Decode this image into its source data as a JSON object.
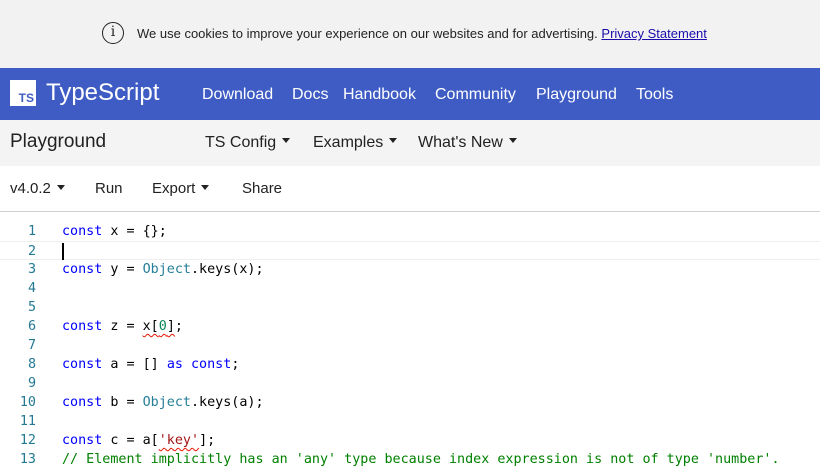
{
  "cookie_banner": {
    "icon": "info-icon",
    "message": "We use cookies to improve your experience on our websites and for advertising.",
    "link": "Privacy Statement"
  },
  "topnav": {
    "logo_text": "TS",
    "brand": "TypeScript",
    "links": [
      "Download",
      "Docs",
      "Handbook",
      "Community",
      "Playground",
      "Tools"
    ],
    "background": "#3f5cc4"
  },
  "playground_header": {
    "title": "Playground",
    "menus": [
      "TS Config",
      "Examples",
      "What's New"
    ]
  },
  "toolbar": {
    "version": "v4.0.2",
    "run": "Run",
    "export": "Export",
    "share": "Share"
  },
  "editor": {
    "line_numbers": [
      "1",
      "2",
      "3",
      "4",
      "5",
      "6",
      "7",
      "8",
      "9",
      "10",
      "11",
      "12",
      "13"
    ],
    "tokens": {
      "const": "const",
      "as": "as",
      "Object": "Object",
      "l1_rest": " x = {};",
      "l3_a": " y = ",
      "l3_b": ".keys(x);",
      "l6_a": " z = ",
      "l6_b": "x[",
      "l6_num": "0",
      "l6_c": "]",
      "l6_d": ";",
      "l8_a": " a = [] ",
      "l8_b": " ",
      "l8_c": ";",
      "l10_a": " b = ",
      "l10_b": ".keys(a);",
      "l12_a": " c = a[",
      "l12_str": "'key'",
      "l12_b": "];",
      "l13_comment": "// Element implicitly has an 'any' type because index expression is not of type 'number'."
    }
  }
}
